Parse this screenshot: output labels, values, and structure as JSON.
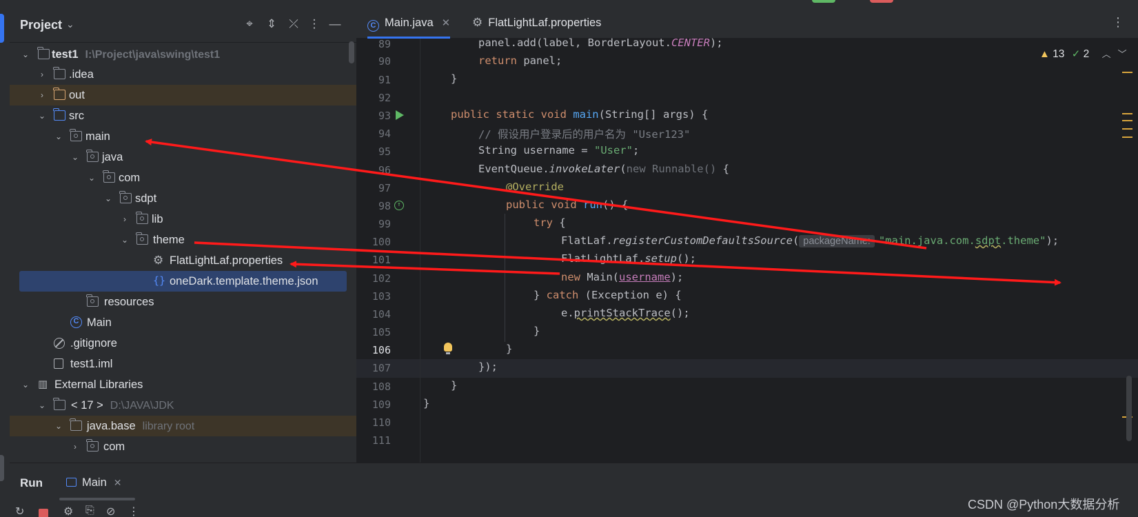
{
  "project": {
    "title": "Project",
    "tree": [
      {
        "label": "test1",
        "hint": "I:\\Project\\java\\swing\\test1"
      },
      {
        "label": ".idea"
      },
      {
        "label": "out"
      },
      {
        "label": "src"
      },
      {
        "label": "main"
      },
      {
        "label": "java"
      },
      {
        "label": "com"
      },
      {
        "label": "sdpt"
      },
      {
        "label": "lib"
      },
      {
        "label": "theme"
      },
      {
        "label": "FlatLightLaf.properties"
      },
      {
        "label": "oneDark.template.theme.json"
      },
      {
        "label": "resources"
      },
      {
        "label": "Main"
      },
      {
        "label": ".gitignore"
      },
      {
        "label": "test1.iml"
      },
      {
        "label": "External Libraries"
      },
      {
        "label": "< 17 >",
        "hint": "D:\\JAVA\\JDK"
      },
      {
        "label": "java.base",
        "hint": "library root"
      },
      {
        "label": "com"
      }
    ]
  },
  "tabs": [
    {
      "label": "Main.java",
      "active": true
    },
    {
      "label": "FlatLightLaf.properties",
      "active": false
    }
  ],
  "inspections": {
    "warnings": "13",
    "ok": "2"
  },
  "code": {
    "line_numbers": [
      "89",
      "90",
      "91",
      "92",
      "93",
      "94",
      "95",
      "96",
      "97",
      "98",
      "99",
      "100",
      "101",
      "102",
      "103",
      "104",
      "105",
      "106",
      "107",
      "108",
      "109",
      "110",
      "111"
    ],
    "current_line": "106",
    "t": {
      "l89": "panel.add(label, BorderLayout.",
      "l89b": "CENTER",
      "l89c": ");",
      "l90a": "return",
      "l90b": " panel;",
      "l91": "}",
      "l93a": "public static void ",
      "l93b": "main",
      "l93c": "(String[] args) {",
      "l94": "// 假设用户登录后的用户名为 \"User123\"",
      "l95a": "String username = ",
      "l95b": "\"User\"",
      "l95c": ";",
      "l96a": "EventQueue.",
      "l96b": "invokeLater",
      "l96c": "(",
      "l96d": "new Runnable()",
      "l96e": " {",
      "l97": "@Override",
      "l98a": "public void ",
      "l98b": "run",
      "l98c": "() {",
      "l99a": "try",
      "l99b": " {",
      "l100a": "FlatLaf.",
      "l100b": "registerCustomDefaultsSource",
      "l100c": "(",
      "l100hint": "packageName:",
      "l100d": "\"main.java.com.",
      "l100e": "sdpt",
      "l100f": ".theme\"",
      "l100g": ");",
      "l101a": "FlatLightLaf.",
      "l101b": "setup",
      "l101c": "();",
      "l102a": "new",
      "l102b": " Main(",
      "l102c": "username",
      "l102d": ");",
      "l103a": "} ",
      "l103b": "catch",
      "l103c": " (Exception e) {",
      "l104a": "e.",
      "l104b": "printStackTrace",
      "l104c": "();",
      "l105": "}",
      "l106": "}",
      "l107": "});",
      "l108": "}",
      "l109": "}"
    }
  },
  "run": {
    "title": "Run",
    "tab": "Main"
  },
  "watermark": "CSDN @Python大数据分析",
  "colors": {
    "accent": "#3574f0",
    "annotation_arrow": "#ff1a1a",
    "keyword": "#cf8e6d",
    "string": "#6aab73"
  }
}
